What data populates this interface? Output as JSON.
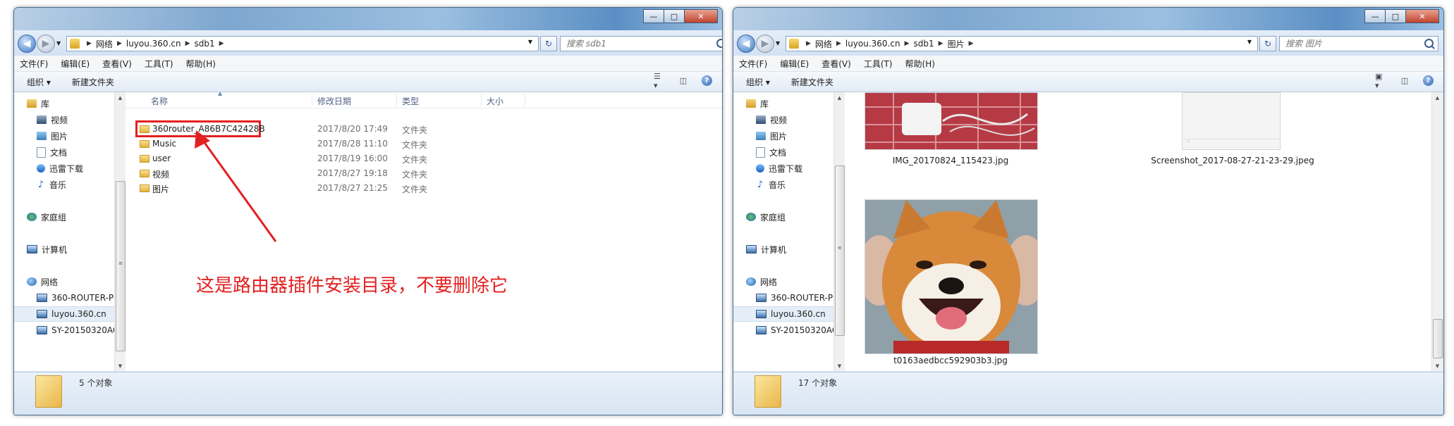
{
  "left_window": {
    "breadcrumb": [
      "网络",
      "luyou.360.cn",
      "sdb1"
    ],
    "search_placeholder": "搜索 sdb1",
    "menu": [
      "文件(F)",
      "编辑(E)",
      "查看(V)",
      "工具(T)",
      "帮助(H)"
    ],
    "toolbar": [
      "组织 ▾",
      "新建文件夹"
    ],
    "nav": [
      {
        "label": "库",
        "icon": "library-icon"
      },
      {
        "label": "视频",
        "icon": "video-icon"
      },
      {
        "label": "图片",
        "icon": "pictures-icon"
      },
      {
        "label": "文档",
        "icon": "documents-icon"
      },
      {
        "label": "迅雷下载",
        "icon": "download-icon"
      },
      {
        "label": "音乐",
        "icon": "music-icon"
      },
      {
        "label": "家庭组",
        "icon": "homegroup-icon"
      },
      {
        "label": "计算机",
        "icon": "computer-icon"
      },
      {
        "label": "网络",
        "icon": "network-icon"
      },
      {
        "label": "360-ROUTER-P",
        "icon": "computer-icon"
      },
      {
        "label": "luyou.360.cn",
        "icon": "computer-icon"
      },
      {
        "label": "SY-20150320AC",
        "icon": "computer-icon"
      }
    ],
    "columns": [
      "名称",
      "修改日期",
      "类型",
      "大小"
    ],
    "files": [
      {
        "name": "360router_A86B7C42428B",
        "date": "2017/8/20 17:49",
        "type": "文件夹"
      },
      {
        "name": "Music",
        "date": "2017/8/28 11:10",
        "type": "文件夹"
      },
      {
        "name": "user",
        "date": "2017/8/19 16:00",
        "type": "文件夹"
      },
      {
        "name": "视频",
        "date": "2017/8/27 19:18",
        "type": "文件夹"
      },
      {
        "name": "图片",
        "date": "2017/8/27 21:25",
        "type": "文件夹"
      }
    ],
    "annotation": "这是路由器插件安装目录，不要删除它",
    "status": "5 个对象",
    "annotation_color": "#e32020"
  },
  "right_window": {
    "breadcrumb": [
      "网络",
      "luyou.360.cn",
      "sdb1",
      "图片"
    ],
    "search_placeholder": "搜索 图片",
    "menu": [
      "文件(F)",
      "编辑(E)",
      "查看(V)",
      "工具(T)",
      "帮助(H)"
    ],
    "toolbar": [
      "组织 ▾",
      "新建文件夹"
    ],
    "nav": [
      {
        "label": "库",
        "icon": "library-icon"
      },
      {
        "label": "视频",
        "icon": "video-icon"
      },
      {
        "label": "图片",
        "icon": "pictures-icon"
      },
      {
        "label": "文档",
        "icon": "documents-icon"
      },
      {
        "label": "迅雷下载",
        "icon": "download-icon"
      },
      {
        "label": "音乐",
        "icon": "music-icon"
      },
      {
        "label": "家庭组",
        "icon": "homegroup-icon"
      },
      {
        "label": "计算机",
        "icon": "computer-icon"
      },
      {
        "label": "网络",
        "icon": "network-icon"
      },
      {
        "label": "360-ROUTER-P",
        "icon": "computer-icon"
      },
      {
        "label": "luyou.360.cn",
        "icon": "computer-icon"
      },
      {
        "label": "SY-20150320AC",
        "icon": "computer-icon"
      }
    ],
    "images": [
      {
        "caption": "IMG_20170824_115423.jpg"
      },
      {
        "caption": "Screenshot_2017-08-27-21-23-29.jpeg"
      },
      {
        "caption": "t0163aedbcc592903b3.jpg"
      }
    ],
    "status": "17 个对象"
  }
}
